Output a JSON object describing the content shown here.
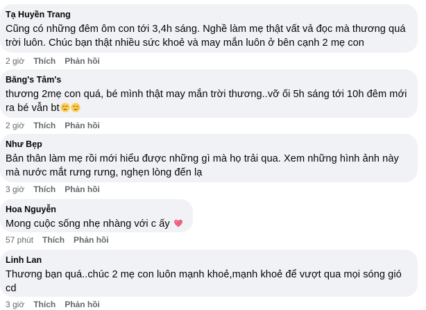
{
  "comments": [
    {
      "author": "Tạ Huyền Trang",
      "text": "Cũng có những đêm ôm con tới 3,4h sáng. Nghề làm mẹ thật vất vả đọc mà thương quá trời luôn. Chúc bạn thật nhiều sức khoẻ và may mắn luôn ở bên cạnh 2 mẹ con",
      "time": "2 giờ",
      "like": "Thích",
      "reply": "Phản hồi"
    },
    {
      "author": "Băng's Tâm's",
      "text": "thương 2mẹ con quá, bé mình thật may mắn trời thương..vỡ ối 5h sáng tới 10h đêm mới ra bé vẫn bt",
      "emojis": [
        "crying-face",
        "crying-face"
      ],
      "time": "2 giờ",
      "like": "Thích",
      "reply": "Phản hồi"
    },
    {
      "author": "Như Bẹp",
      "text": "Bản thân làm mẹ rồi mới hiểu được những gì mà họ trải qua. Xem những hình ảnh này mà nước mắt rưng rưng, nghẹn lòng đến lạ",
      "time": "3 giờ",
      "like": "Thích",
      "reply": "Phản hồi"
    },
    {
      "author": "Hoa Nguyễn",
      "text": "Mong cuộc sống nhẹ nhàng với c ấy",
      "emojis": [
        "pink-heart"
      ],
      "time": "57 phút",
      "like": "Thích",
      "reply": "Phản hồi"
    },
    {
      "author": "Linh Lan",
      "text": "Thương bạn quá..chúc 2 mẹ con luôn mạnh khoẻ,mạnh khoẻ để vượt qua mọi sóng gió cd",
      "time": "3 giờ",
      "like": "Thích",
      "reply": "Phản hồi"
    }
  ],
  "colors": {
    "bubble": "#f0f2f5",
    "text": "#050505",
    "meta": "#65676b",
    "heart": "#f0607f",
    "emoji": "#ffcc4d"
  }
}
